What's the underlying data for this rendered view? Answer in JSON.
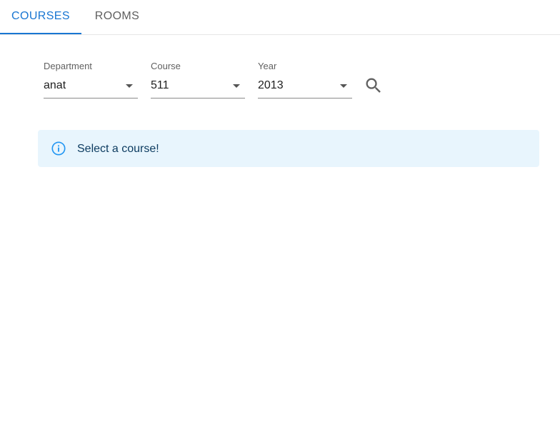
{
  "tabs": [
    {
      "label": "COURSES",
      "selected": true
    },
    {
      "label": "ROOMS",
      "selected": false
    }
  ],
  "filters": {
    "department": {
      "label": "Department",
      "value": "anat"
    },
    "course": {
      "label": "Course",
      "value": "511"
    },
    "year": {
      "label": "Year",
      "value": "2013"
    }
  },
  "alert": {
    "type": "info",
    "message": "Select a course!"
  },
  "icons": {
    "search": "search-icon",
    "info": "info-icon",
    "dropdown": "arrow-drop-down-icon"
  },
  "colors": {
    "primary": "#1976d2",
    "info_background": "#e8f5fd",
    "info_icon": "#2196f3",
    "info_text": "#0d3c61"
  }
}
